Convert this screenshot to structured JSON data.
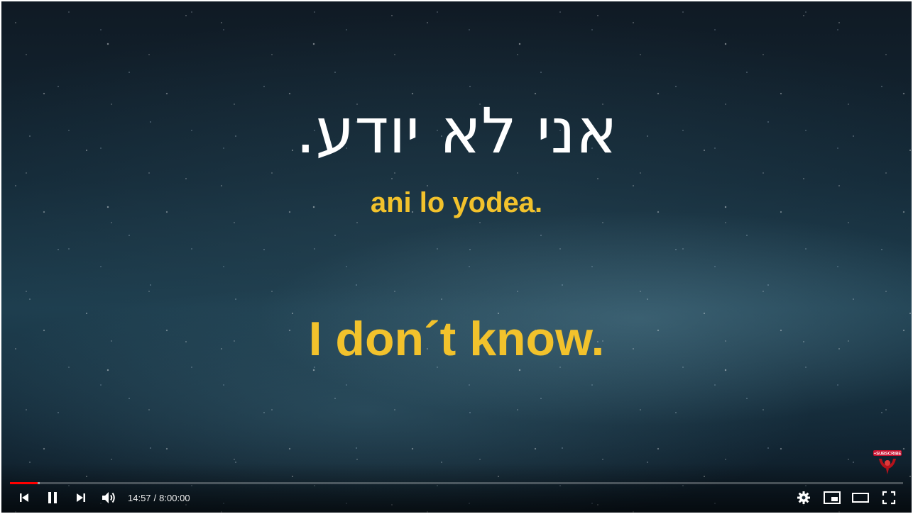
{
  "video": {
    "hebrew_line": "אני לא יודע.",
    "transliteration": "ani lo yodea.",
    "translation": "I don´t know."
  },
  "player": {
    "current_time": "14:57",
    "separator": "/",
    "duration": "8:00:00",
    "progress_played_fraction": 0.031,
    "progress_loaded_fraction": 0.033,
    "accent_color": "#ff0000",
    "caption_color": "#f2c22c"
  },
  "controls": {
    "left": [
      "previous-icon",
      "pause-icon",
      "next-icon",
      "volume-icon"
    ],
    "right": [
      "settings-icon",
      "miniplayer-icon",
      "theater-mode-icon",
      "fullscreen-icon"
    ]
  },
  "branding": {
    "subscribe_badge_text": "+SUBSCRIBE"
  }
}
